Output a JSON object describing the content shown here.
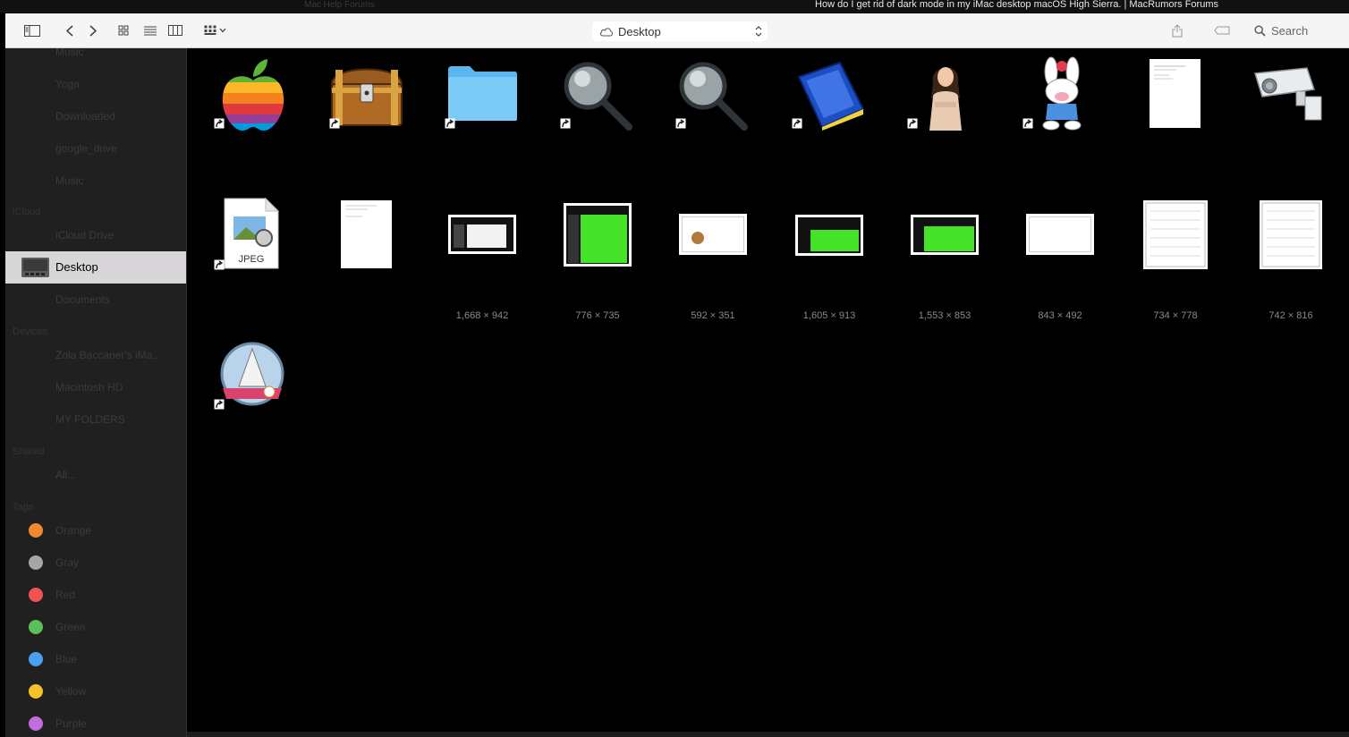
{
  "window": {
    "browser_tab_title": "How do I get rid of dark mode in my iMac desktop macOS High Sierra. | MacRumors Forums",
    "faint_tab_title": "Mac Help Forums"
  },
  "toolbar": {
    "location": "Desktop",
    "search_label": "Search"
  },
  "sidebar": {
    "items_top": [
      "Music",
      "Yoga",
      "Downloaded",
      "google_drive",
      "Music"
    ],
    "icloud_header": "iCloud",
    "icloud_items": [
      "iCloud Drive"
    ],
    "selected": "Desktop",
    "icloud_items_after": [
      "Documents"
    ],
    "devices_header": "Devices",
    "devices": [
      "Zola Baccaner's iMa...",
      "Macintosh HD",
      "MY FOLDERS"
    ],
    "shared_header": "Shared",
    "shared": [
      "All..."
    ],
    "tags_header": "Tags",
    "tags": [
      {
        "name": "Orange",
        "color": "#f0892f"
      },
      {
        "name": "Gray",
        "color": "#a6a6a6"
      },
      {
        "name": "Red",
        "color": "#f05252"
      },
      {
        "name": "Green",
        "color": "#5ac05a"
      },
      {
        "name": "Blue",
        "color": "#4a9ff0"
      },
      {
        "name": "Yellow",
        "color": "#f4c22b"
      },
      {
        "name": "Purple",
        "color": "#c46de0"
      }
    ]
  },
  "files": {
    "jpeg_label": "JPEG",
    "dimensions": [
      "1,668 × 942",
      "776 × 735",
      "592 × 351",
      "1,605 × 913",
      "1,553 × 853",
      "843 × 492",
      "734 × 778",
      "742 × 816"
    ]
  }
}
